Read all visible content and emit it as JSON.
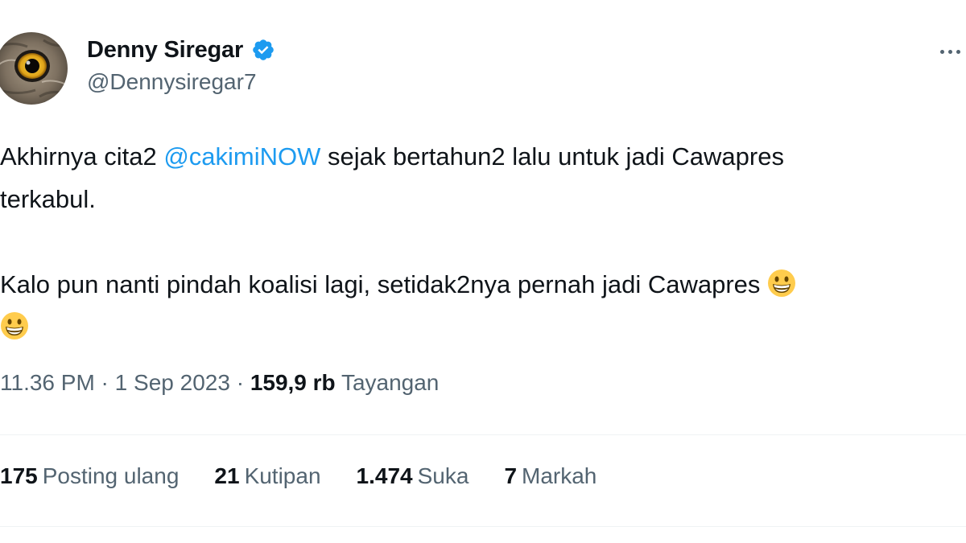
{
  "author": {
    "display_name": "Denny Siregar",
    "handle": "@Dennysiregar7",
    "verified_icon": "verified-badge-icon",
    "avatar_icon": "owl-eye-avatar"
  },
  "tweet": {
    "line1_before": "Akhirnya cita2 ",
    "mention": "@cakimiNOW",
    "line1_after": " sejak bertahun2 lalu untuk jadi Cawapres",
    "line2": "terkabul.",
    "line3": "Kalo pun nanti pindah koalisi lagi, setidak2nya pernah jadi Cawapres",
    "emoji_icon": "grinning-face-emoji"
  },
  "meta": {
    "time": "11.36 PM",
    "sep1": " · ",
    "date": "1 Sep 2023",
    "sep2": " · ",
    "views_count": "159,9 rb",
    "views_label": " Tayangan"
  },
  "stats": [
    {
      "count": "175",
      "label": "Posting ulang"
    },
    {
      "count": "21",
      "label": "Kutipan"
    },
    {
      "count": "1.474",
      "label": "Suka"
    },
    {
      "count": "7",
      "label": "Markah"
    }
  ],
  "colors": {
    "text": "#0f1419",
    "secondary": "#536471",
    "accent": "#1d9bf0",
    "divider": "#eff3f4"
  }
}
